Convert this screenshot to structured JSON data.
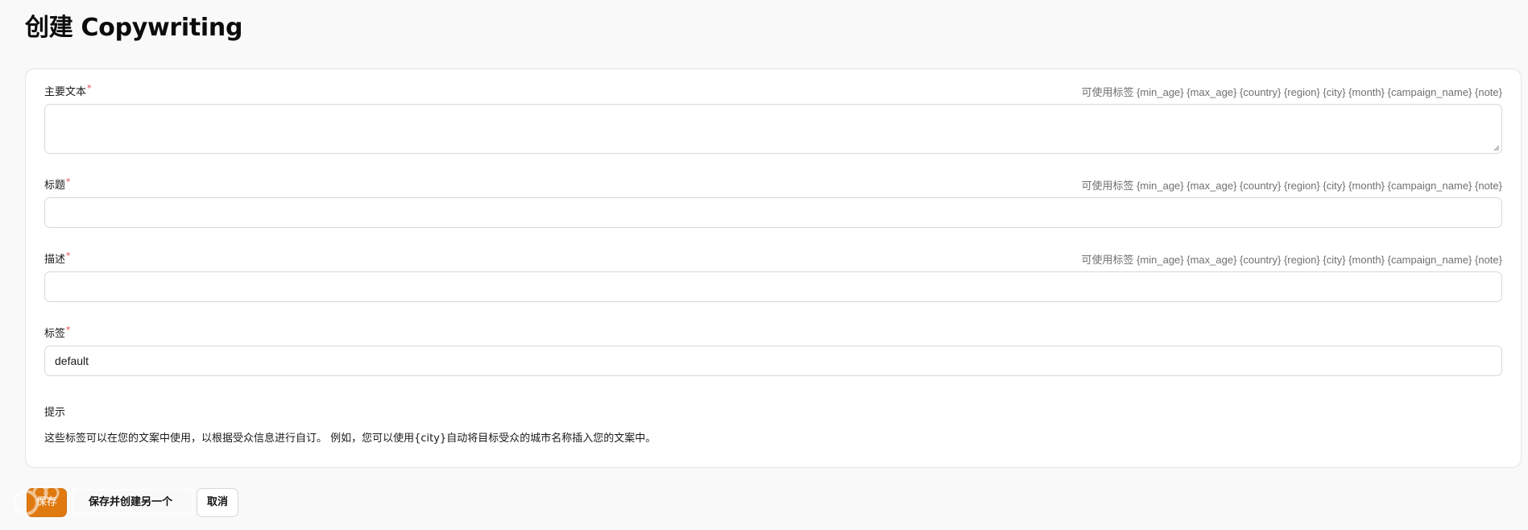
{
  "page": {
    "title": "创建 Copywriting"
  },
  "form": {
    "tag_hint": "可使用标签 {min_age} {max_age} {country} {region} {city} {month} {campaign_name} {note}",
    "required_mark": "*",
    "primary_text": {
      "label": "主要文本",
      "value": ""
    },
    "headline": {
      "label": "标题",
      "value": ""
    },
    "description": {
      "label": "描述",
      "value": ""
    },
    "tags": {
      "label": "标签",
      "value": "default"
    }
  },
  "tips": {
    "title": "提示",
    "text": "这些标签可以在您的文案中使用，以根据受众信息进行自订。 例如，您可以使用{city}自动将目标受众的城市名称插入您的文案中。"
  },
  "actions": {
    "save_label": "保存",
    "save_and_create_label": "保存并创建另一个",
    "cancel_label": "取消"
  },
  "colors": {
    "primary_button": "#e07a10",
    "required_mark": "#e5484d",
    "hint_text": "#707070",
    "border": "#d8d8d8"
  }
}
